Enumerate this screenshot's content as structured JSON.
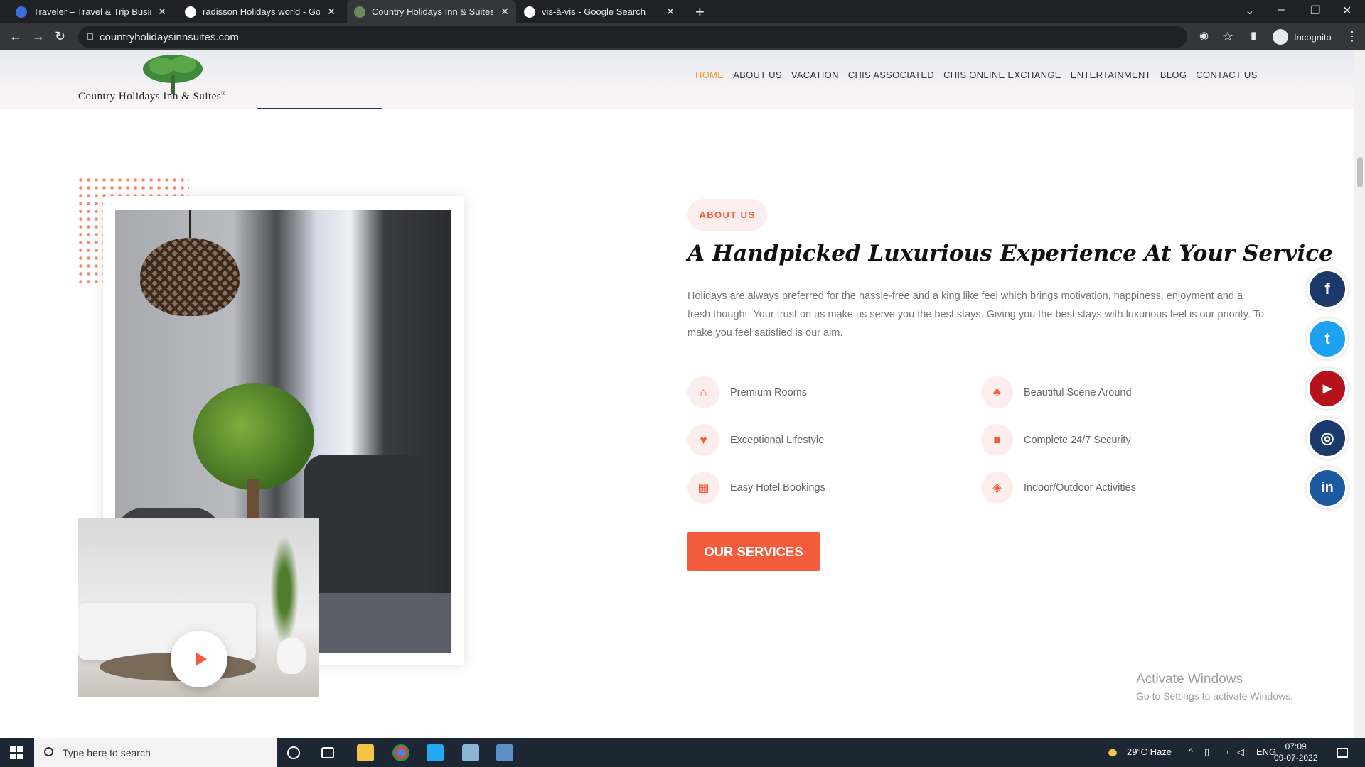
{
  "browser": {
    "tabs": [
      {
        "title": "Traveler – Travel & Trip Business"
      },
      {
        "title": "radisson Holidays world - Google"
      },
      {
        "title": "Country Holidays Inn & Suites | H"
      },
      {
        "title": "vis-à-vis - Google Search"
      }
    ],
    "url": "countryholidaysinnsuites.com",
    "profile_label": "Incognito"
  },
  "site": {
    "logo_text": "Country Holidays Inn & Suites",
    "logo_mark": "®",
    "nav": [
      "HOME",
      "ABOUT US",
      "VACATION",
      "CHIS ASSOCIATED",
      "CHIS ONLINE EXCHANGE",
      "ENTERTAINMENT",
      "BLOG",
      "CONTACT US"
    ],
    "nav_active": "HOME"
  },
  "about": {
    "badge": "ABOUT US",
    "headline": "A Handpicked Luxurious Experience At Your Service",
    "description": "Holidays are always preferred for the hassle-free and a king like feel which brings motivation, happiness, enjoyment and a fresh thought. Your trust on us make us serve you the best stays. Giving you the best stays with luxurious feel is our priority. To make you feel satisfied is our aim.",
    "features": [
      {
        "label": "Premium Rooms",
        "icon": "home-icon"
      },
      {
        "label": "Beautiful Scene Around",
        "icon": "tree-icon"
      },
      {
        "label": "Exceptional Lifestyle",
        "icon": "heart-icon"
      },
      {
        "label": "Complete 24/7 Security",
        "icon": "lock-icon"
      },
      {
        "label": "Easy Hotel Bookings",
        "icon": "building-icon"
      },
      {
        "label": "Indoor/Outdoor Activities",
        "icon": "gamepad-icon"
      }
    ],
    "cta": "OUR SERVICES"
  },
  "social": [
    {
      "name": "facebook-icon",
      "glyph": "f",
      "color": "#1b3a6b"
    },
    {
      "name": "twitter-icon",
      "glyph": "t",
      "color": "#1da1f2"
    },
    {
      "name": "youtube-icon",
      "glyph": "▶",
      "color": "#b5121b"
    },
    {
      "name": "instagram-icon",
      "glyph": "◎",
      "color": "#1b3a6b"
    },
    {
      "name": "linkedin-icon",
      "glyph": "in",
      "color": "#1b5a9e"
    }
  ],
  "watermark": {
    "line1": "Activate Windows",
    "line2": "Go to Settings to activate Windows."
  },
  "taskbar": {
    "search_placeholder": "Type here to search",
    "weather": "29°C  Haze",
    "lang": "ENG",
    "time": "07:09",
    "date": "09-07-2022"
  },
  "colors": {
    "accent": "#f25c3c",
    "nav_active": "#f59a2f"
  }
}
